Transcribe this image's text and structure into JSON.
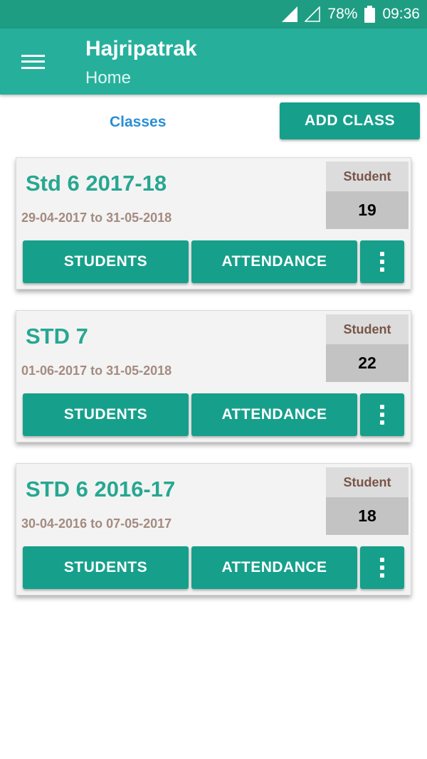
{
  "status_bar": {
    "battery": "78%",
    "time": "09:36",
    "icons": [
      "signal-icon",
      "signal-empty-icon",
      "battery-icon"
    ]
  },
  "app_bar": {
    "title": "Hajripatrak",
    "subtitle": "Home",
    "menu_icon": "hamburger-menu-icon"
  },
  "toolbar": {
    "classes_label": "Classes",
    "add_class_label": "ADD CLASS"
  },
  "classes": [
    {
      "name": "Std 6 2017-18",
      "dates": "29-04-2017 to 31-05-2018",
      "count_label": "Student",
      "count": "19",
      "students_label": "STUDENTS",
      "attendance_label": "ATTENDANCE"
    },
    {
      "name": "STD 7",
      "dates": "01-06-2017 to 31-05-2018",
      "count_label": "Student",
      "count": "22",
      "students_label": "STUDENTS",
      "attendance_label": "ATTENDANCE"
    },
    {
      "name": "STD 6 2016-17",
      "dates": "30-04-2016 to 07-05-2017",
      "count_label": "Student",
      "count": "18",
      "students_label": "STUDENTS",
      "attendance_label": "ATTENDANCE"
    }
  ],
  "colors": {
    "status_bar": "#1f9d83",
    "app_bar": "#26b09c",
    "button": "#16a08b",
    "card_title": "#27a791",
    "link": "#2a8fd3",
    "dates": "#a48b80",
    "count_label": "#795548"
  }
}
